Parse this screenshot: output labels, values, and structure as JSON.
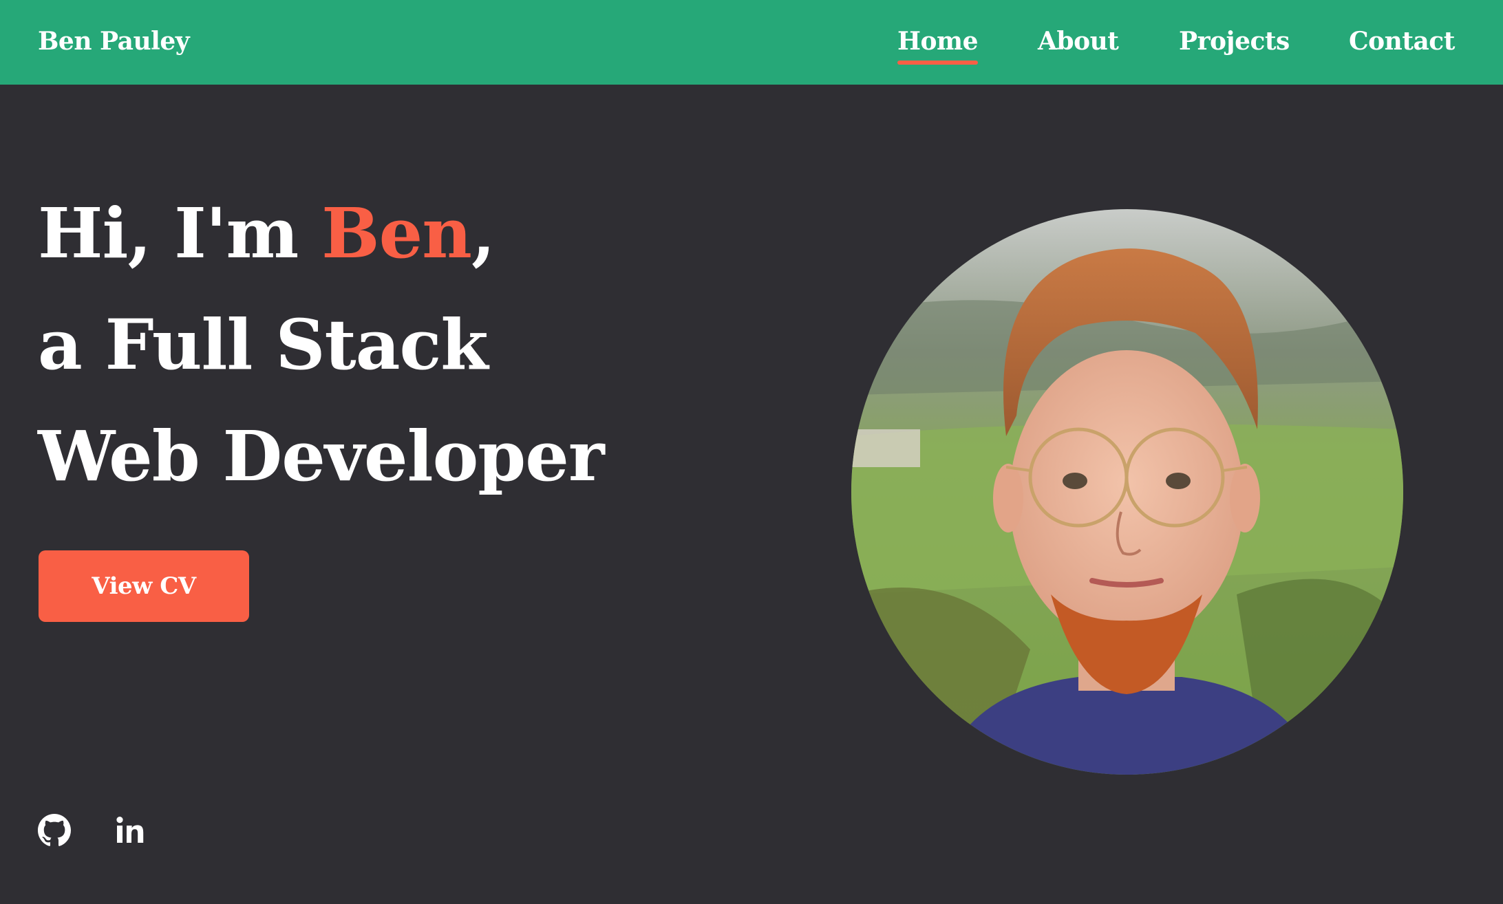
{
  "header": {
    "brand": "Ben Pauley",
    "nav": [
      {
        "label": "Home",
        "active": true
      },
      {
        "label": "About",
        "active": false
      },
      {
        "label": "Projects",
        "active": false
      },
      {
        "label": "Contact",
        "active": false
      }
    ]
  },
  "hero": {
    "greeting_prefix": "Hi, I'm ",
    "name": "Ben",
    "greeting_suffix": ",",
    "line2": "a Full Stack",
    "line3": "Web Developer"
  },
  "cv_button": {
    "label": "View CV"
  },
  "social": [
    {
      "icon": "github-icon"
    },
    {
      "icon": "linkedin-icon"
    }
  ],
  "colors": {
    "nav_background": "#26a878",
    "page_background": "#2f2e33",
    "accent": "#f95f45",
    "text": "#ffffff"
  }
}
